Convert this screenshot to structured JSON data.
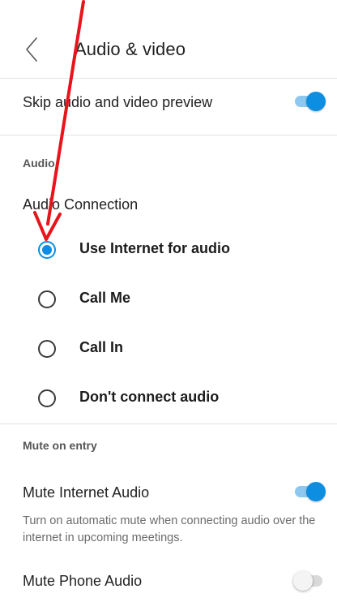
{
  "header": {
    "title": "Audio & video",
    "back_icon": "chevron-left-icon"
  },
  "skip_preview": {
    "label": "Skip audio and video preview",
    "enabled": true
  },
  "audio_section": {
    "heading": "Audio",
    "connection_label": "Audio Connection",
    "options": [
      {
        "label": "Use Internet for audio",
        "selected": true
      },
      {
        "label": "Call Me",
        "selected": false
      },
      {
        "label": "Call In",
        "selected": false
      },
      {
        "label": "Don't connect audio",
        "selected": false
      }
    ]
  },
  "mute_section": {
    "heading": "Mute on entry",
    "internet_audio": {
      "label": "Mute Internet Audio",
      "enabled": true,
      "description": "Turn on automatic mute when connecting audio over the internet in upcoming meetings."
    },
    "phone_audio": {
      "label": "Mute Phone Audio",
      "enabled": false
    }
  },
  "colors": {
    "accent": "#0e8ee0",
    "annotation_arrow": "#e8141b"
  }
}
